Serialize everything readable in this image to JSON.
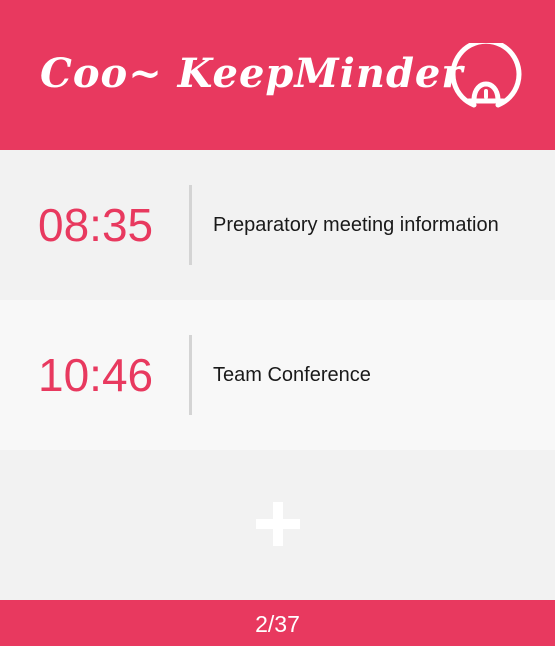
{
  "header": {
    "app_title": "Coo~ KeepMinder",
    "bell_icon": "bell-icon"
  },
  "reminders": [
    {
      "time": "08:35",
      "title": "Preparatory meeting information"
    },
    {
      "time": "10:46",
      "title": "Team Conference"
    }
  ],
  "add_button": {
    "icon": "plus-icon"
  },
  "footer": {
    "page_indicator": "2/37"
  },
  "colors": {
    "accent": "#e8395f",
    "row_light": "#f2f2f2",
    "row_alt": "#f8f8f8",
    "divider": "#d4d4d4"
  }
}
